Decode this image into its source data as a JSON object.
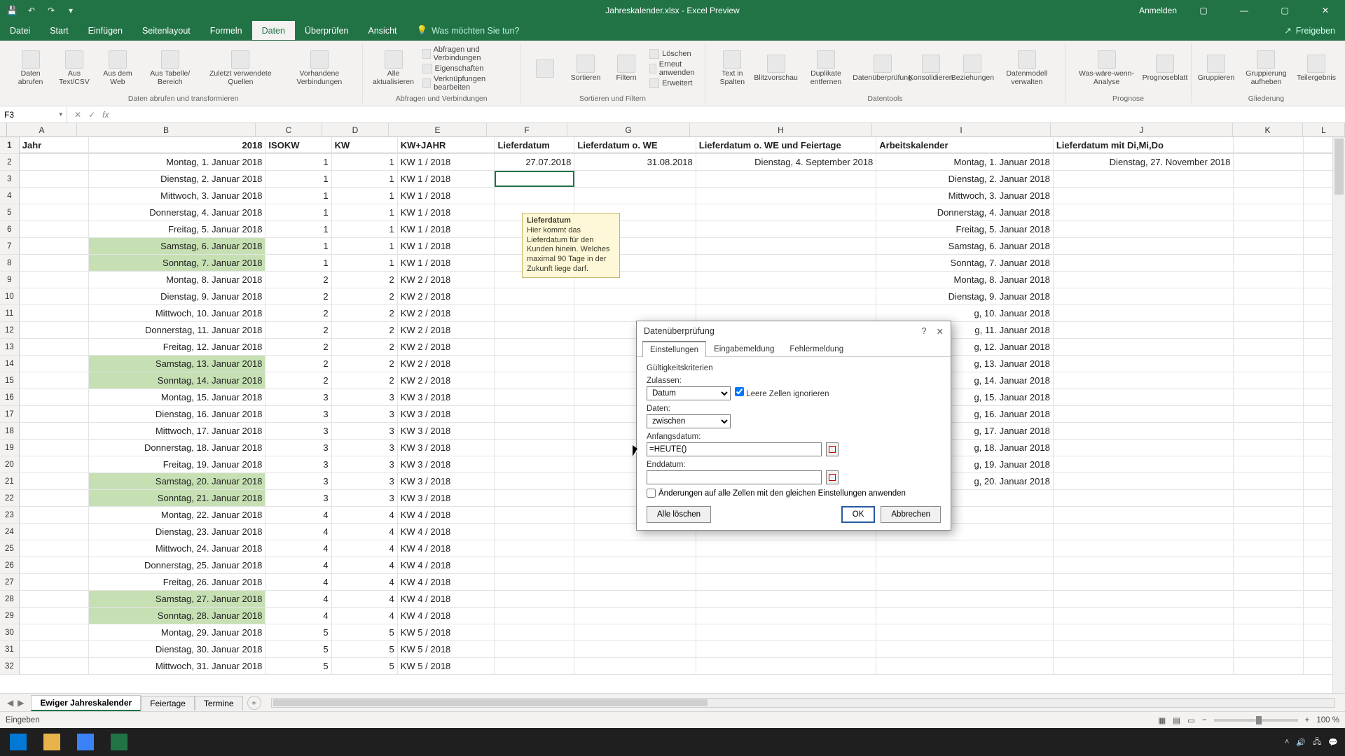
{
  "titlebar": {
    "doc": "Jahreskalender.xlsx - Excel Preview",
    "signin": "Anmelden"
  },
  "tabs": {
    "file": "Datei",
    "home": "Start",
    "insert": "Einfügen",
    "layout": "Seitenlayout",
    "formulas": "Formeln",
    "data": "Daten",
    "review": "Überprüfen",
    "view": "Ansicht",
    "tellme": "Was möchten Sie tun?",
    "share": "Freigeben"
  },
  "ribbon": {
    "get": {
      "label": "Daten abrufen und transformieren",
      "b1": "Daten abrufen",
      "b2": "Aus Text/CSV",
      "b3": "Aus dem Web",
      "b4": "Aus Tabelle/ Bereich",
      "b5": "Zuletzt verwendete Quellen",
      "b6": "Vorhandene Verbindungen"
    },
    "conn": {
      "label": "Abfragen und Verbindungen",
      "refresh": "Alle aktualisieren",
      "l1": "Abfragen und Verbindungen",
      "l2": "Eigenschaften",
      "l3": "Verknüpfungen bearbeiten"
    },
    "sort": {
      "label": "Sortieren und Filtern",
      "sort": "Sortieren",
      "filter": "Filtern",
      "l1": "Löschen",
      "l2": "Erneut anwenden",
      "l3": "Erweitert"
    },
    "tools": {
      "label": "Datentools",
      "b1": "Text in Spalten",
      "b2": "Blitzvorschau",
      "b3": "Duplikate entfernen",
      "b4": "Datenüberprüfung",
      "b5": "Konsolidieren",
      "b6": "Beziehungen",
      "b7": "Datenmodell verwalten"
    },
    "forecast": {
      "label": "Prognose",
      "b1": "Was-wäre-wenn-Analyse",
      "b2": "Prognoseblatt"
    },
    "outline": {
      "label": "Gliederung",
      "b1": "Gruppieren",
      "b2": "Gruppierung aufheben",
      "b3": "Teilergebnis"
    }
  },
  "namebox": "F3",
  "columns": [
    "A",
    "B",
    "C",
    "D",
    "E",
    "F",
    "G",
    "H",
    "I",
    "J",
    "K",
    "L"
  ],
  "headers": {
    "A": "Jahr",
    "B": "2018",
    "C": "ISOKW",
    "D": "KW",
    "E": "KW+JAHR",
    "F": "Lieferdatum",
    "G": "Lieferdatum o. WE",
    "H": "Lieferdatum o. WE und Feiertage",
    "I": "Arbeitskalender",
    "J": "Lieferdatum mit Di,Mi,Do"
  },
  "row2": {
    "F": "27.07.2018",
    "G": "31.08.2018",
    "H": "Dienstag, 4. September 2018",
    "J": "Dienstag, 27. November 2018"
  },
  "rows": [
    {
      "n": 2,
      "B": "Montag, 1. Januar 2018",
      "C": 1,
      "D": 1,
      "E": "KW 1 / 2018",
      "I": "Montag, 1. Januar 2018",
      "we": false
    },
    {
      "n": 3,
      "B": "Dienstag, 2. Januar 2018",
      "C": 1,
      "D": 1,
      "E": "KW 1 / 2018",
      "I": "Dienstag, 2. Januar 2018",
      "we": false
    },
    {
      "n": 4,
      "B": "Mittwoch, 3. Januar 2018",
      "C": 1,
      "D": 1,
      "E": "KW 1 / 2018",
      "I": "Mittwoch, 3. Januar 2018",
      "we": false
    },
    {
      "n": 5,
      "B": "Donnerstag, 4. Januar 2018",
      "C": 1,
      "D": 1,
      "E": "KW 1 / 2018",
      "I": "Donnerstag, 4. Januar 2018",
      "we": false
    },
    {
      "n": 6,
      "B": "Freitag, 5. Januar 2018",
      "C": 1,
      "D": 1,
      "E": "KW 1 / 2018",
      "I": "Freitag, 5. Januar 2018",
      "we": false
    },
    {
      "n": 7,
      "B": "Samstag, 6. Januar 2018",
      "C": 1,
      "D": 1,
      "E": "KW 1 / 2018",
      "I": "Samstag, 6. Januar 2018",
      "we": true
    },
    {
      "n": 8,
      "B": "Sonntag, 7. Januar 2018",
      "C": 1,
      "D": 1,
      "E": "KW 1 / 2018",
      "I": "Sonntag, 7. Januar 2018",
      "we": true
    },
    {
      "n": 9,
      "B": "Montag, 8. Januar 2018",
      "C": 2,
      "D": 2,
      "E": "KW 2 / 2018",
      "I": "Montag, 8. Januar 2018",
      "we": false
    },
    {
      "n": 10,
      "B": "Dienstag, 9. Januar 2018",
      "C": 2,
      "D": 2,
      "E": "KW 2 / 2018",
      "I": "Dienstag, 9. Januar 2018",
      "we": false
    },
    {
      "n": 11,
      "B": "Mittwoch, 10. Januar 2018",
      "C": 2,
      "D": 2,
      "E": "KW 2 / 2018",
      "I": "g, 10. Januar 2018",
      "we": false
    },
    {
      "n": 12,
      "B": "Donnerstag, 11. Januar 2018",
      "C": 2,
      "D": 2,
      "E": "KW 2 / 2018",
      "I": "g, 11. Januar 2018",
      "we": false
    },
    {
      "n": 13,
      "B": "Freitag, 12. Januar 2018",
      "C": 2,
      "D": 2,
      "E": "KW 2 / 2018",
      "I": "g, 12. Januar 2018",
      "we": false
    },
    {
      "n": 14,
      "B": "Samstag, 13. Januar 2018",
      "C": 2,
      "D": 2,
      "E": "KW 2 / 2018",
      "I": "g, 13. Januar 2018",
      "we": true
    },
    {
      "n": 15,
      "B": "Sonntag, 14. Januar 2018",
      "C": 2,
      "D": 2,
      "E": "KW 2 / 2018",
      "I": "g, 14. Januar 2018",
      "we": true
    },
    {
      "n": 16,
      "B": "Montag, 15. Januar 2018",
      "C": 3,
      "D": 3,
      "E": "KW 3 / 2018",
      "I": "g, 15. Januar 2018",
      "we": false
    },
    {
      "n": 17,
      "B": "Dienstag, 16. Januar 2018",
      "C": 3,
      "D": 3,
      "E": "KW 3 / 2018",
      "I": "g, 16. Januar 2018",
      "we": false
    },
    {
      "n": 18,
      "B": "Mittwoch, 17. Januar 2018",
      "C": 3,
      "D": 3,
      "E": "KW 3 / 2018",
      "I": "g, 17. Januar 2018",
      "we": false
    },
    {
      "n": 19,
      "B": "Donnerstag, 18. Januar 2018",
      "C": 3,
      "D": 3,
      "E": "KW 3 / 2018",
      "I": "g, 18. Januar 2018",
      "we": false
    },
    {
      "n": 20,
      "B": "Freitag, 19. Januar 2018",
      "C": 3,
      "D": 3,
      "E": "KW 3 / 2018",
      "I": "g, 19. Januar 2018",
      "we": false
    },
    {
      "n": 21,
      "B": "Samstag, 20. Januar 2018",
      "C": 3,
      "D": 3,
      "E": "KW 3 / 2018",
      "I": "g, 20. Januar 2018",
      "we": true
    },
    {
      "n": 22,
      "B": "Sonntag, 21. Januar 2018",
      "C": 3,
      "D": 3,
      "E": "KW 3 / 2018",
      "I": "",
      "we": true
    },
    {
      "n": 23,
      "B": "Montag, 22. Januar 2018",
      "C": 4,
      "D": 4,
      "E": "KW 4 / 2018",
      "I": "",
      "we": false
    },
    {
      "n": 24,
      "B": "Dienstag, 23. Januar 2018",
      "C": 4,
      "D": 4,
      "E": "KW 4 / 2018",
      "I": "",
      "we": false
    },
    {
      "n": 25,
      "B": "Mittwoch, 24. Januar 2018",
      "C": 4,
      "D": 4,
      "E": "KW 4 / 2018",
      "I": "",
      "we": false
    },
    {
      "n": 26,
      "B": "Donnerstag, 25. Januar 2018",
      "C": 4,
      "D": 4,
      "E": "KW 4 / 2018",
      "I": "",
      "we": false
    },
    {
      "n": 27,
      "B": "Freitag, 26. Januar 2018",
      "C": 4,
      "D": 4,
      "E": "KW 4 / 2018",
      "I": "",
      "we": false
    },
    {
      "n": 28,
      "B": "Samstag, 27. Januar 2018",
      "C": 4,
      "D": 4,
      "E": "KW 4 / 2018",
      "I": "",
      "we": true
    },
    {
      "n": 29,
      "B": "Sonntag, 28. Januar 2018",
      "C": 4,
      "D": 4,
      "E": "KW 4 / 2018",
      "I": "",
      "we": true
    },
    {
      "n": 30,
      "B": "Montag, 29. Januar 2018",
      "C": 5,
      "D": 5,
      "E": "KW 5 / 2018",
      "I": "",
      "we": false
    },
    {
      "n": 31,
      "B": "Dienstag, 30. Januar 2018",
      "C": 5,
      "D": 5,
      "E": "KW 5 / 2018",
      "I": "",
      "we": false
    },
    {
      "n": 32,
      "B": "Mittwoch, 31. Januar 2018",
      "C": 5,
      "D": 5,
      "E": "KW 5 / 2018",
      "I": "",
      "we": false
    }
  ],
  "tooltip": {
    "title": "Lieferdatum",
    "body": "Hier kommt das Lieferdatum für den Kunden hinein. Welches maximal 90 Tage in der Zukunft liege darf."
  },
  "dialog": {
    "title": "Datenüberprüfung",
    "tabs": {
      "settings": "Einstellungen",
      "input": "Eingabemeldung",
      "error": "Fehlermeldung"
    },
    "criteria": "Gültigkeitskriterien",
    "allow_label": "Zulassen:",
    "allow_value": "Datum",
    "ignore_blank": "Leere Zellen ignorieren",
    "data_label": "Daten:",
    "data_value": "zwischen",
    "start_label": "Anfangsdatum:",
    "start_value": "=HEUTE()",
    "end_label": "Enddatum:",
    "end_value": "",
    "apply_all": "Änderungen auf alle Zellen mit den gleichen Einstellungen anwenden",
    "clear": "Alle löschen",
    "ok": "OK",
    "cancel": "Abbrechen"
  },
  "sheets": {
    "s1": "Ewiger Jahreskalender",
    "s2": "Feiertage",
    "s3": "Termine"
  },
  "status": {
    "mode": "Eingeben",
    "zoom": "100 %"
  }
}
